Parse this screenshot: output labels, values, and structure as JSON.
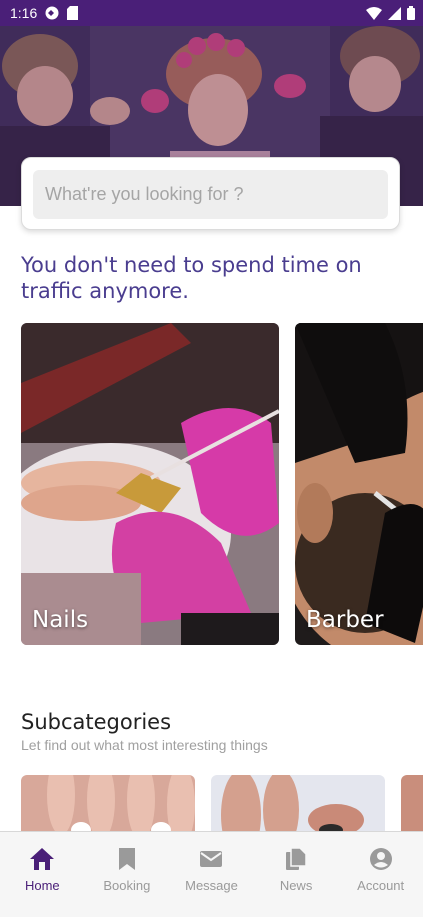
{
  "status_bar": {
    "time": "1:16",
    "left_icons": [
      "media-icon",
      "sim-card-icon"
    ],
    "right_icons": [
      "wifi-icon",
      "signal-icon",
      "battery-icon"
    ]
  },
  "search": {
    "placeholder": "What're you looking for ?"
  },
  "headline": "You don't need to spend time on traffic anymore.",
  "categories": [
    {
      "label": "Nails"
    },
    {
      "label": "Barber"
    }
  ],
  "subcategories": {
    "title": "Subcategories",
    "description": "Let find out what most interesting things"
  },
  "bottom_nav": {
    "items": [
      {
        "label": "Home",
        "icon": "home-icon",
        "active": true
      },
      {
        "label": "Booking",
        "icon": "bookmark-icon",
        "active": false
      },
      {
        "label": "Message",
        "icon": "mail-icon",
        "active": false
      },
      {
        "label": "News",
        "icon": "documents-icon",
        "active": false
      },
      {
        "label": "Account",
        "icon": "account-icon",
        "active": false
      }
    ]
  },
  "colors": {
    "primary": "#4a1f78",
    "headline": "#4a3d8f",
    "muted": "#9a9a9a"
  }
}
